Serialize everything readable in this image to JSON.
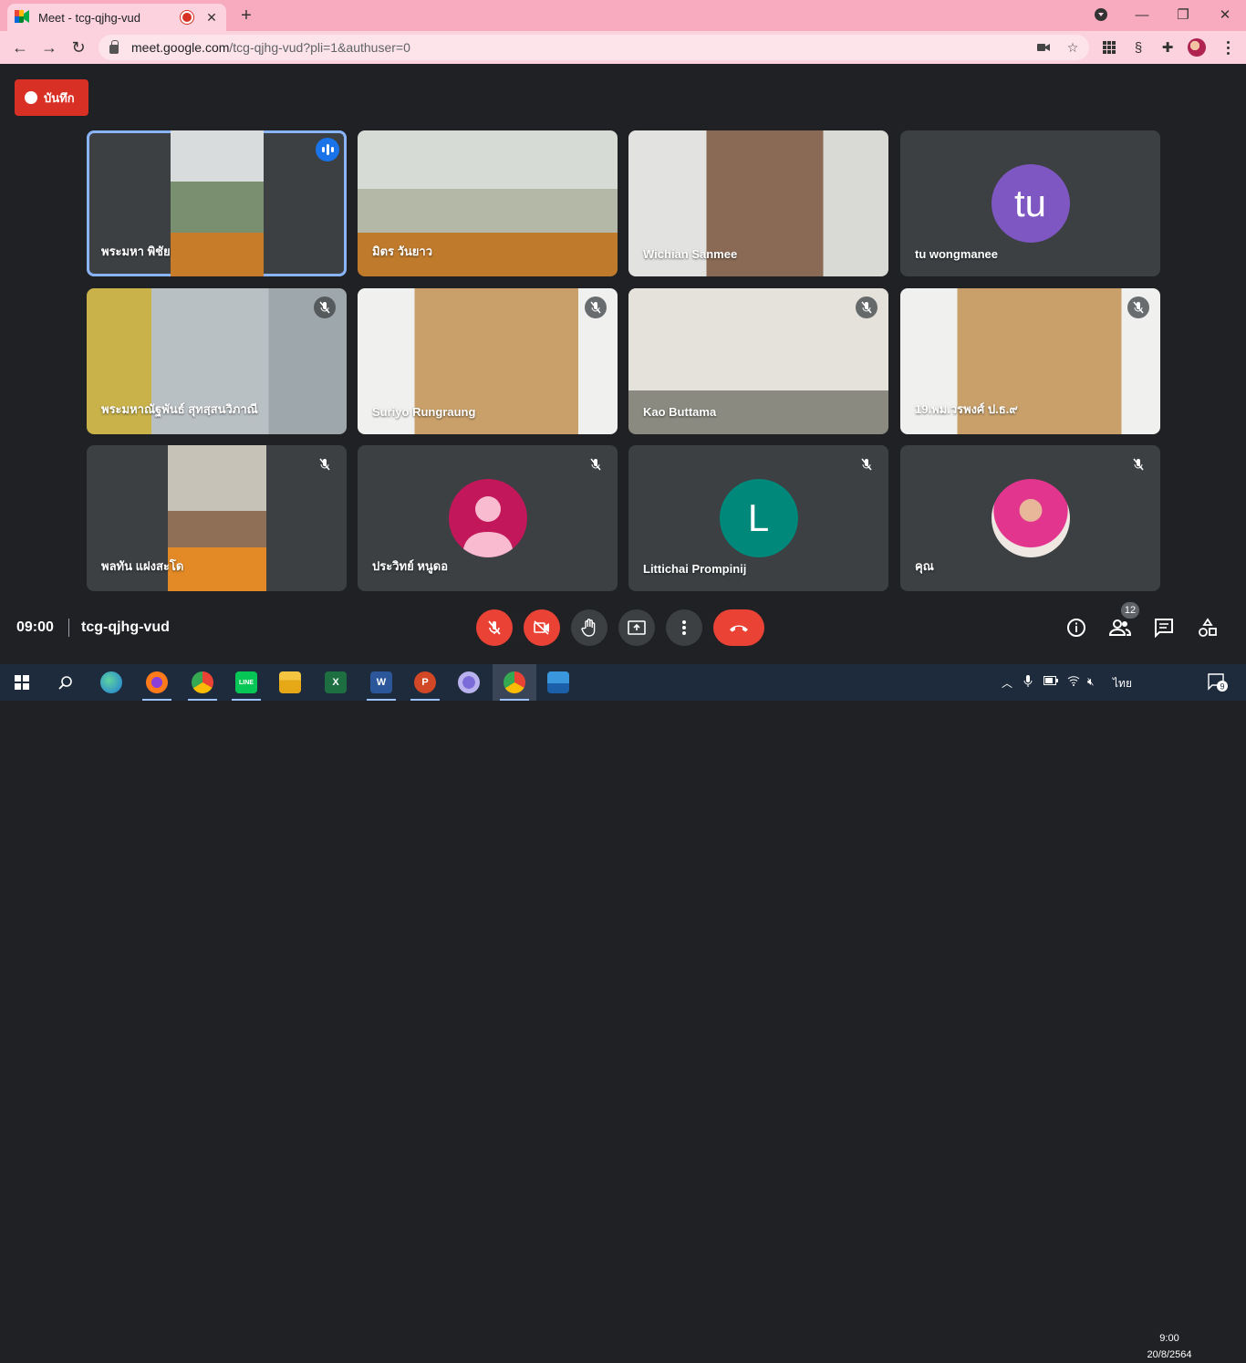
{
  "browser": {
    "tab_title": "Meet - tcg-qjhg-vud",
    "url_host": "meet.google.com",
    "url_path": "/tcg-qjhg-vud?pli=1&authuser=0",
    "tab_bg": "#fbd2de",
    "chrome_bg": "#f8aabf"
  },
  "record_label": "บันทึก",
  "participants": [
    {
      "name": "พระมหา พิชัย",
      "speaking": true
    },
    {
      "name": "มิตร วันยาว"
    },
    {
      "name": "Wichian Sanmee"
    },
    {
      "name": "tu wongmanee",
      "initials": "tu",
      "color": "#7e57c2"
    },
    {
      "name": "พระมหาณัฐพันธ์ สุทสฺสนวิภาณี",
      "muted": true
    },
    {
      "name": "Suriyo Rungraung",
      "muted": true
    },
    {
      "name": "Kao Buttama",
      "muted": true
    },
    {
      "name": "19.พม.วรพงศ์ ป.ธ.๙",
      "muted": true
    },
    {
      "name": "พลทัน แฝงสะโด",
      "muted": true
    },
    {
      "name": "ประวิทย์ หนูดอ",
      "muted": true,
      "color": "#c2185b"
    },
    {
      "name": "Littichai Prompinij",
      "muted": true,
      "initials": "L",
      "color": "#00897b"
    },
    {
      "name": "คุณ",
      "muted": true
    }
  ],
  "meeting": {
    "time": "09:00",
    "code": "tcg-qjhg-vud",
    "participant_count": "12"
  },
  "taskbar": {
    "lang": "ไทย",
    "time": "9:00",
    "date": "20/8/2564",
    "notifications": "9"
  }
}
